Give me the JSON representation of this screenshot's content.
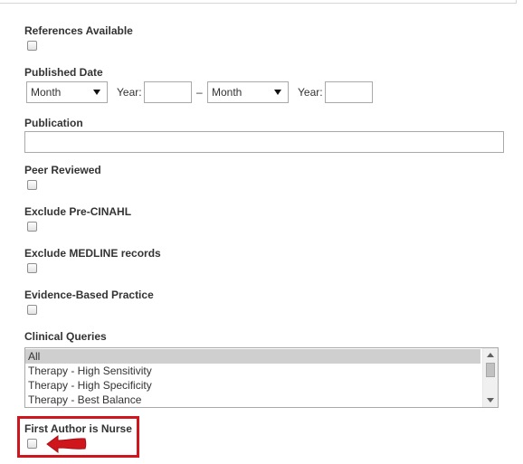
{
  "fields": {
    "references": {
      "label": "References Available",
      "checked": false
    },
    "published_date": {
      "label": "Published Date",
      "from_month": "Month",
      "year_label_1": "Year:",
      "from_year": "",
      "separator": "–",
      "to_month": "Month",
      "year_label_2": "Year:",
      "to_year": ""
    },
    "publication": {
      "label": "Publication",
      "value": ""
    },
    "peer_reviewed": {
      "label": "Peer Reviewed",
      "checked": false
    },
    "exclude_pre_cinahl": {
      "label": "Exclude Pre-CINAHL",
      "checked": false
    },
    "exclude_medline": {
      "label": "Exclude MEDLINE records",
      "checked": false
    },
    "evidence_based": {
      "label": "Evidence-Based Practice",
      "checked": false
    },
    "clinical_queries": {
      "label": "Clinical Queries",
      "options": [
        "All",
        "Therapy - High Sensitivity",
        "Therapy - High Specificity",
        "Therapy - Best Balance"
      ],
      "selected": "All"
    },
    "first_author_nurse": {
      "label": "First Author is Nurse",
      "checked": false
    }
  },
  "annotation": {
    "highlight_color": "#d0161d",
    "arrow_color": "#d0161d",
    "target_icon": "left-arrow-icon"
  }
}
